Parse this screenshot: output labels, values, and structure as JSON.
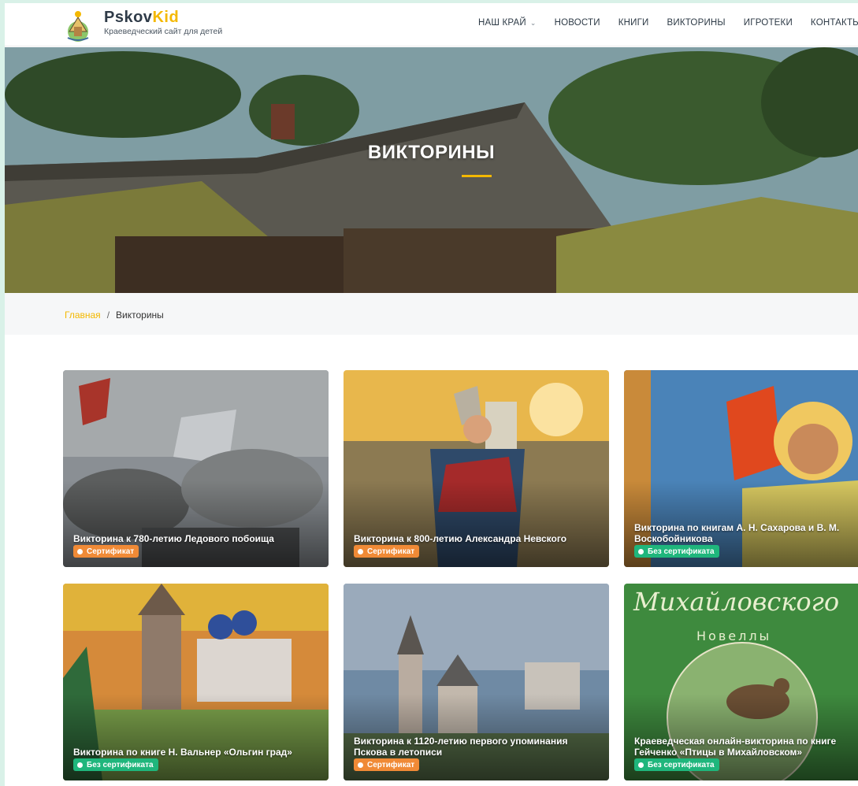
{
  "site": {
    "brand_part1": "Pskov",
    "brand_part2": "Kid",
    "tagline": "Краеведческий сайт для детей"
  },
  "nav": [
    {
      "label": "НАШ КРАЙ",
      "has_dropdown": true
    },
    {
      "label": "НОВОСТИ"
    },
    {
      "label": "КНИГИ"
    },
    {
      "label": "ВИКТОРИНЫ"
    },
    {
      "label": "ИГРОТЕКИ"
    },
    {
      "label": "КОНТАКТЫ"
    }
  ],
  "hero": {
    "title": "ВИКТОРИНЫ"
  },
  "breadcrumb": {
    "home": "Главная",
    "separator": "/",
    "current": "Викторины"
  },
  "cards": [
    {
      "title": "Викторина к 780-летию Ледового побоища",
      "badge": "Сертификат",
      "badge_color": "#f08a36"
    },
    {
      "title": "Викторина к 800-летию Александра Невского",
      "badge": "Сертификат",
      "badge_color": "#f08a36"
    },
    {
      "title": "Викторина по книгам А. Н. Сахарова и В. М. Воскобойникова",
      "badge": "Без сертификата",
      "badge_color": "#1fb67c"
    },
    {
      "title": "Викторина по книге Н. Вальнер «Ольгин град»",
      "badge": "Без сертификата",
      "badge_color": "#1fb67c"
    },
    {
      "title": "Викторина к 1120-летию первого упоминания Пскова в летописи",
      "badge": "Сертификат",
      "badge_color": "#f08a36"
    },
    {
      "title": "Краеведческая онлайн-викторина по книге Гейченко «Птицы в Михайловском»",
      "badge": "Без сертификата",
      "badge_color": "#1fb67c"
    }
  ],
  "card_cover_text": {
    "script_title": "Михайловского",
    "subtitle": "Новеллы"
  },
  "colors": {
    "accent": "#f4b800",
    "certificate": "#f08a36",
    "no_certificate": "#1fb67c",
    "page_bg": "#d9f1e8"
  }
}
